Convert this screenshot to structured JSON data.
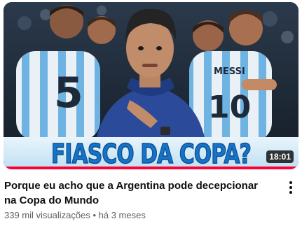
{
  "video": {
    "thumbnail_text": "FIASCO DA COPA?",
    "duration": "18:01",
    "watch_progress": 1.0,
    "title": "Porque eu acho que a Argentina pode decepcionar na Copa do Mundo",
    "views": "339 mil visualizações",
    "separator": "•",
    "age": "há 3 meses",
    "jersey_numbers": [
      "5",
      "10"
    ],
    "jersey_name": "MESSI"
  },
  "icons": {
    "menu": "more-vert-icon"
  },
  "colors": {
    "progress": "#ff0033",
    "banner_text": "#1673c8",
    "title_text": "#0f0f0f",
    "meta_text": "#606060"
  }
}
